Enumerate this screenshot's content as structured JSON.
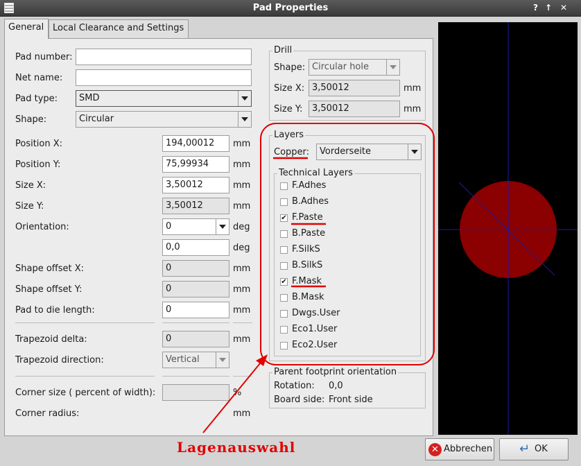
{
  "window": {
    "title": "Pad Properties",
    "btn_help": "?",
    "btn_max": "↑",
    "btn_close": "✕"
  },
  "tabs": [
    {
      "label": "General"
    },
    {
      "label": "Local Clearance and Settings"
    }
  ],
  "general": {
    "pad_number": {
      "label": "Pad number:",
      "value": ""
    },
    "net_name": {
      "label": "Net name:",
      "value": ""
    },
    "pad_type": {
      "label": "Pad type:",
      "value": "SMD"
    },
    "shape": {
      "label": "Shape:",
      "value": "Circular"
    },
    "position_x": {
      "label": "Position X:",
      "value": "194,00012",
      "unit": "mm"
    },
    "position_y": {
      "label": "Position Y:",
      "value": "75,99934",
      "unit": "mm"
    },
    "size_x": {
      "label": "Size X:",
      "value": "3,50012",
      "unit": "mm"
    },
    "size_y": {
      "label": "Size Y:",
      "value": "3,50012",
      "unit": "mm"
    },
    "orientation": {
      "label": "Orientation:",
      "value": "0",
      "unit": "deg",
      "value2": "0,0",
      "unit2": "deg"
    },
    "shape_offset_x": {
      "label": "Shape offset X:",
      "value": "0",
      "unit": "mm"
    },
    "shape_offset_y": {
      "label": "Shape offset Y:",
      "value": "0",
      "unit": "mm"
    },
    "pad_to_die": {
      "label": "Pad to die length:",
      "value": "0",
      "unit": "mm"
    },
    "trapezoid_delta": {
      "label": "Trapezoid delta:",
      "value": "0",
      "unit": "mm"
    },
    "trapezoid_direction": {
      "label": "Trapezoid direction:",
      "value": "Vertical"
    },
    "corner_size": {
      "label": "Corner size ( percent of width):",
      "value": "",
      "unit": "%"
    },
    "corner_radius": {
      "label": "Corner radius:",
      "unit": "mm"
    }
  },
  "drill": {
    "title": "Drill",
    "shape_label": "Shape:",
    "shape_value": "Circular hole",
    "size_x_label": "Size X:",
    "size_x_value": "3,50012",
    "size_y_label": "Size Y:",
    "size_y_value": "3,50012",
    "unit": "mm"
  },
  "layers": {
    "title": "Layers",
    "copper_label": "Copper:",
    "copper_value": "Vorderseite",
    "technical_title": "Technical Layers",
    "items": [
      {
        "name": "F.Adhes",
        "checked": false
      },
      {
        "name": "B.Adhes",
        "checked": false
      },
      {
        "name": "F.Paste",
        "checked": true
      },
      {
        "name": "B.Paste",
        "checked": false
      },
      {
        "name": "F.SilkS",
        "checked": false
      },
      {
        "name": "B.SilkS",
        "checked": false
      },
      {
        "name": "F.Mask",
        "checked": true
      },
      {
        "name": "B.Mask",
        "checked": false
      },
      {
        "name": "Dwgs.User",
        "checked": false
      },
      {
        "name": "Eco1.User",
        "checked": false
      },
      {
        "name": "Eco2.User",
        "checked": false
      }
    ]
  },
  "parent": {
    "title": "Parent footprint orientation",
    "rotation_label": "Rotation:",
    "rotation_value": "0,0",
    "side_label": "Board side:",
    "side_value": "Front side"
  },
  "buttons": {
    "cancel": "Abbrechen",
    "ok": "OK"
  },
  "annotation": {
    "text": "Lagenauswahl"
  },
  "colors": {
    "pad": "#8b0000",
    "crosshair": "#1a1aa8",
    "annotation": "#e00000",
    "preview_bg": "#000000"
  }
}
